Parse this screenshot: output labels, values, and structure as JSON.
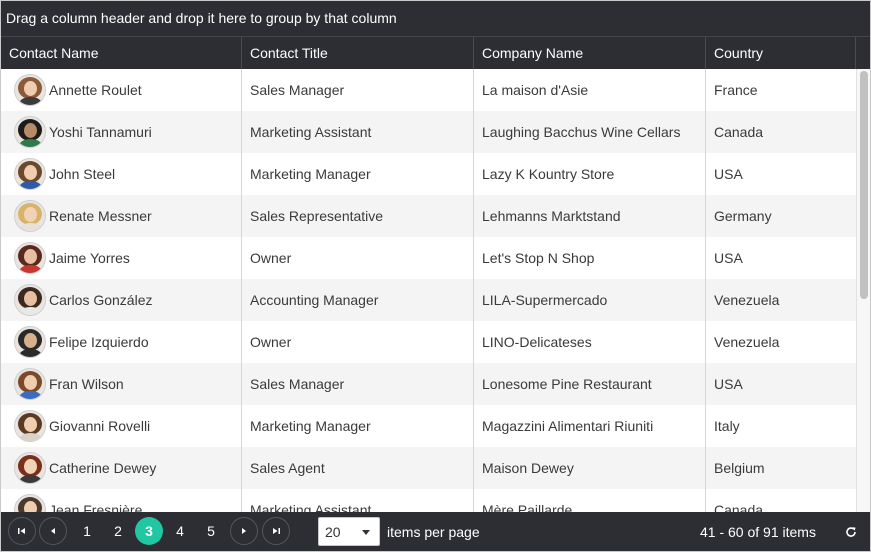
{
  "group_panel": {
    "text": "Drag a column header and drop it here to group by that column"
  },
  "columns": [
    "Contact Name",
    "Contact Title",
    "Company Name",
    "Country"
  ],
  "rows": [
    {
      "name": "Annette Roulet",
      "title": "Sales Manager",
      "company": "La maison d'Asie",
      "country": "France",
      "hair": "#8a5a3a",
      "shirt": "#3b3b3b",
      "skin": "#efcdb0"
    },
    {
      "name": "Yoshi Tannamuri",
      "title": "Marketing Assistant",
      "company": "Laughing Bacchus Wine Cellars",
      "country": "Canada",
      "hair": "#1c1c1c",
      "shirt": "#2f7a4a",
      "skin": "#b98a66"
    },
    {
      "name": "John Steel",
      "title": "Marketing Manager",
      "company": "Lazy K Kountry Store",
      "country": "USA",
      "hair": "#6b4a2b",
      "shirt": "#2e5aa8",
      "skin": "#efcdb0"
    },
    {
      "name": "Renate Messner",
      "title": "Sales Representative",
      "company": "Lehmanns Marktstand",
      "country": "Germany",
      "hair": "#d8b46a",
      "shirt": "#e6e1da",
      "skin": "#f0d2b6"
    },
    {
      "name": "Jaime Yorres",
      "title": "Owner",
      "company": "Let's Stop N Shop",
      "country": "USA",
      "hair": "#5a2a1e",
      "shirt": "#c8362f",
      "skin": "#e6c0a0"
    },
    {
      "name": "Carlos González",
      "title": "Accounting Manager",
      "company": "LILA-Supermercado",
      "country": "Venezuela",
      "hair": "#3a2a20",
      "shirt": "#e8e8e8",
      "skin": "#e6c0a0"
    },
    {
      "name": "Felipe Izquierdo",
      "title": "Owner",
      "company": "LINO-Delicateses",
      "country": "Venezuela",
      "hair": "#2a2a2a",
      "shirt": "#2b2b2b",
      "skin": "#d9b08c"
    },
    {
      "name": "Fran Wilson",
      "title": "Sales Manager",
      "company": "Lonesome Pine Restaurant",
      "country": "USA",
      "hair": "#7a4a2a",
      "shirt": "#3a6cc0",
      "skin": "#efcdb0"
    },
    {
      "name": "Giovanni Rovelli",
      "title": "Marketing Manager",
      "company": "Magazzini Alimentari Riuniti",
      "country": "Italy",
      "hair": "#5a3a22",
      "shirt": "#d8d2c8",
      "skin": "#efcdb0"
    },
    {
      "name": "Catherine Dewey",
      "title": "Sales Agent",
      "company": "Maison Dewey",
      "country": "Belgium",
      "hair": "#7a2e1c",
      "shirt": "#3a3a3a",
      "skin": "#f0d2b6"
    },
    {
      "name": "Jean Fresnière",
      "title": "Marketing Assistant",
      "company": "Mère Paillarde",
      "country": "Canada",
      "hair": "#4a3a2e",
      "shirt": "#d0d0d0",
      "skin": "#efcdb0"
    }
  ],
  "pager": {
    "first_icon": "first-page-icon",
    "prev_icon": "prev-page-icon",
    "next_icon": "next-page-icon",
    "last_icon": "last-page-icon",
    "pages": [
      "1",
      "2",
      "3",
      "4",
      "5"
    ],
    "active_page": "3",
    "page_size": "20",
    "items_per_page_label": "items per page",
    "info": "41 - 60 of 91 items",
    "refresh_icon": "refresh-icon",
    "accent_color": "#21c6a2"
  },
  "scrollbar": {
    "position_fraction": 0.0,
    "visible_fraction": 0.52
  }
}
